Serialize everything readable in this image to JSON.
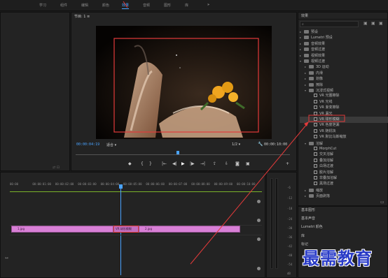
{
  "workspaces": [
    "学习",
    "组件",
    "编辑",
    "颜色",
    "效果",
    "音频",
    "图形",
    "库",
    "»"
  ],
  "active_workspace": "效果",
  "program_monitor": {
    "title": "节目: 1 ≡",
    "timecode_current": "00:00:04:19",
    "fit_label": "适合",
    "quality_label": "1/2",
    "timecode_end": "00:00:10:00"
  },
  "effects_panel": {
    "title": "效果",
    "search_placeholder": "",
    "tree": [
      {
        "level": 0,
        "type": "folder",
        "label": "预设",
        "open": false
      },
      {
        "level": 0,
        "type": "folder",
        "label": "Lumetri 预设",
        "open": false
      },
      {
        "level": 0,
        "type": "folder",
        "label": "音频效果",
        "open": false
      },
      {
        "level": 0,
        "type": "folder",
        "label": "音频过渡",
        "open": false
      },
      {
        "level": 0,
        "type": "folder",
        "label": "视频效果",
        "open": false
      },
      {
        "level": 0,
        "type": "folder",
        "label": "视频过渡",
        "open": true
      },
      {
        "level": 1,
        "type": "folder",
        "label": "3D 运动",
        "open": false
      },
      {
        "level": 1,
        "type": "folder",
        "label": "内滑",
        "open": false
      },
      {
        "level": 1,
        "type": "folder",
        "label": "划像",
        "open": false
      },
      {
        "level": 1,
        "type": "folder",
        "label": "擦除",
        "open": false
      },
      {
        "level": 1,
        "type": "folder",
        "label": "沉浸式视频",
        "open": true
      },
      {
        "level": 2,
        "type": "fx",
        "label": "VR 光圈擦除"
      },
      {
        "level": 2,
        "type": "fx",
        "label": "VR 光线"
      },
      {
        "level": 2,
        "type": "fx",
        "label": "VR 渐变擦除"
      },
      {
        "level": 2,
        "type": "fx",
        "label": "VR 漏光"
      },
      {
        "level": 2,
        "type": "fx",
        "label": "VR 球形模糊",
        "selected": true
      },
      {
        "level": 2,
        "type": "fx",
        "label": "VR 色度泄漏"
      },
      {
        "level": 2,
        "type": "fx",
        "label": "VR 随机块"
      },
      {
        "level": 2,
        "type": "fx",
        "label": "VR 默比乌斯缩放"
      },
      {
        "level": 1,
        "type": "folder",
        "label": "溶解",
        "open": true
      },
      {
        "level": 2,
        "type": "fx",
        "label": "MorphCut"
      },
      {
        "level": 2,
        "type": "fx",
        "label": "交叉溶解"
      },
      {
        "level": 2,
        "type": "fx",
        "label": "叠加溶解"
      },
      {
        "level": 2,
        "type": "fx",
        "label": "白场过渡"
      },
      {
        "level": 2,
        "type": "fx",
        "label": "胶片溶解"
      },
      {
        "level": 2,
        "type": "fx",
        "label": "非叠加溶解"
      },
      {
        "level": 2,
        "type": "fx",
        "label": "黑场过渡"
      },
      {
        "level": 1,
        "type": "folder",
        "label": "缩放",
        "open": false
      },
      {
        "level": 1,
        "type": "folder",
        "label": "页面剥落",
        "open": false
      }
    ]
  },
  "right_stack": [
    "基本图形",
    "基本声音",
    "Lumetri 颜色",
    "库",
    "标记"
  ],
  "timeline": {
    "ruler": [
      "00:00",
      "00:00:01:00",
      "00:00:02:00",
      "00:00:03:00",
      "00:00:04:00",
      "00:00:05:00",
      "00:00:06:00",
      "00:00:07:00",
      "00:00:08:00",
      "00:00:09:00",
      "00:00:10:00"
    ],
    "clip1": "1.jpg",
    "transition": "VR 球形模糊",
    "clip2": "2.jpg"
  },
  "meter_labels": [
    "-6",
    "-12",
    "-18",
    "-24",
    "-30",
    "-36",
    "-42",
    "-48",
    "-54",
    "dB"
  ],
  "watermark": "最需教育",
  "colors": {
    "accent": "#4aa3ff",
    "clip": "#d87fd6",
    "annotation": "#e23a3a",
    "watermark": "#2a3cc7"
  }
}
